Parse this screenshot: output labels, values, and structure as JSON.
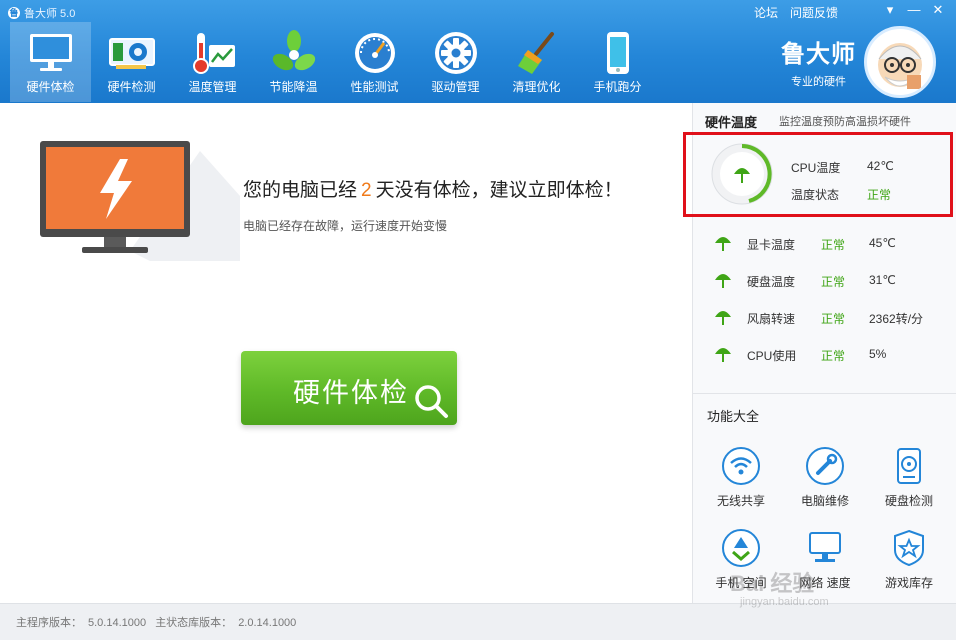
{
  "window": {
    "title": "鲁大师 5.0",
    "links": [
      "论坛",
      "问题反馈"
    ],
    "controls": [
      "▾",
      "—",
      "✕"
    ]
  },
  "nav": [
    {
      "label": "硬件体检",
      "icon": "monitor-icon",
      "active": true
    },
    {
      "label": "硬件检测",
      "icon": "graphics-card-icon",
      "active": false
    },
    {
      "label": "温度管理",
      "icon": "thermometer-icon",
      "active": false
    },
    {
      "label": "节能降温",
      "icon": "fan-icon",
      "active": false
    },
    {
      "label": "性能测试",
      "icon": "speedometer-icon",
      "active": false
    },
    {
      "label": "驱动管理",
      "icon": "gear-icon",
      "active": false
    },
    {
      "label": "清理优化",
      "icon": "broom-icon",
      "active": false
    },
    {
      "label": "手机跑分",
      "icon": "phone-icon",
      "active": false
    }
  ],
  "brand": {
    "name": "鲁大师",
    "slogan": "专业的硬件"
  },
  "main": {
    "msg_prefix": "您的电脑已经",
    "days": "2",
    "msg_suffix": "天没有体检，建议立即体检！",
    "sub": "电脑已经存在故障，运行速度开始变慢",
    "button": "硬件体检"
  },
  "side": {
    "title": "硬件温度",
    "hint": "监控温度预防高温损坏硬件",
    "cpu_temp_label": "CPU温度",
    "cpu_temp_value": "42℃",
    "temp_state_label": "温度状态",
    "temp_state_value": "正常",
    "rows": [
      {
        "label": "显卡温度",
        "status": "正常",
        "value": "45℃"
      },
      {
        "label": "硬盘温度",
        "status": "正常",
        "value": "31℃"
      },
      {
        "label": "风扇转速",
        "status": "正常",
        "value": "2362转/分"
      },
      {
        "label": "CPU使用",
        "status": "正常",
        "value": "5%"
      }
    ],
    "func_title": "功能大全",
    "funcs": [
      {
        "label": "无线共享",
        "icon": "wifi-icon"
      },
      {
        "label": "电脑维修",
        "icon": "wrench-icon"
      },
      {
        "label": "硬盘检测",
        "icon": "harddisk-icon"
      },
      {
        "label": "手机 空间",
        "icon": "recycle-icon"
      },
      {
        "label": "网络 速度",
        "icon": "network-icon"
      },
      {
        "label": "游戏库存",
        "icon": "shield-star-icon"
      }
    ]
  },
  "status": {
    "main_ver_label": "主程序版本：",
    "main_ver": "5.0.14.1000",
    "db_ver_label": "主状态库版本：",
    "db_ver": "2.0.14.1000"
  },
  "watermark": {
    "logo": "Bai 经验",
    "url": "jingyan.baidu.com"
  },
  "colors": {
    "accent": "#2486d8",
    "green": "#5fb928",
    "orange": "#f07a1a",
    "alert": "#e0101a"
  }
}
